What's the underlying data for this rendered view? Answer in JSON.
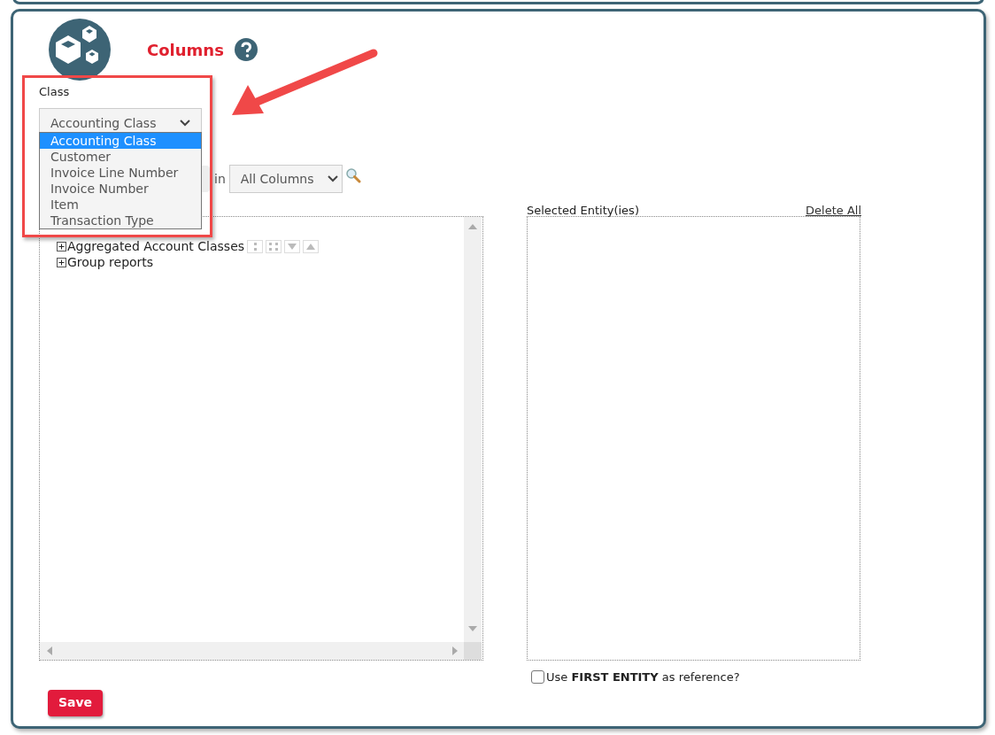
{
  "header": {
    "title": "Columns"
  },
  "class_field": {
    "label": "Class",
    "value": "Accounting Class",
    "expanded": true,
    "options": [
      {
        "label": "Accounting Class",
        "selected": true
      },
      {
        "label": "Customer",
        "selected": false
      },
      {
        "label": "Invoice Line Number",
        "selected": false
      },
      {
        "label": "Invoice Number",
        "selected": false
      },
      {
        "label": "Item",
        "selected": false
      },
      {
        "label": "Transaction Type",
        "selected": false
      }
    ]
  },
  "search": {
    "connector": "in",
    "scope": "All Columns"
  },
  "tree": {
    "items": [
      {
        "label": "Aggregated Account Classes",
        "expanded": false,
        "has_tools": true
      },
      {
        "label": "Group reports",
        "expanded": false,
        "has_tools": false
      }
    ]
  },
  "selected_panel": {
    "title": "Selected Entity(ies)",
    "delete_all": "Delete All"
  },
  "reference_option": {
    "label": "Use **FIRST ENTITY** as reference?",
    "checked": false
  },
  "save_button": "Save"
}
